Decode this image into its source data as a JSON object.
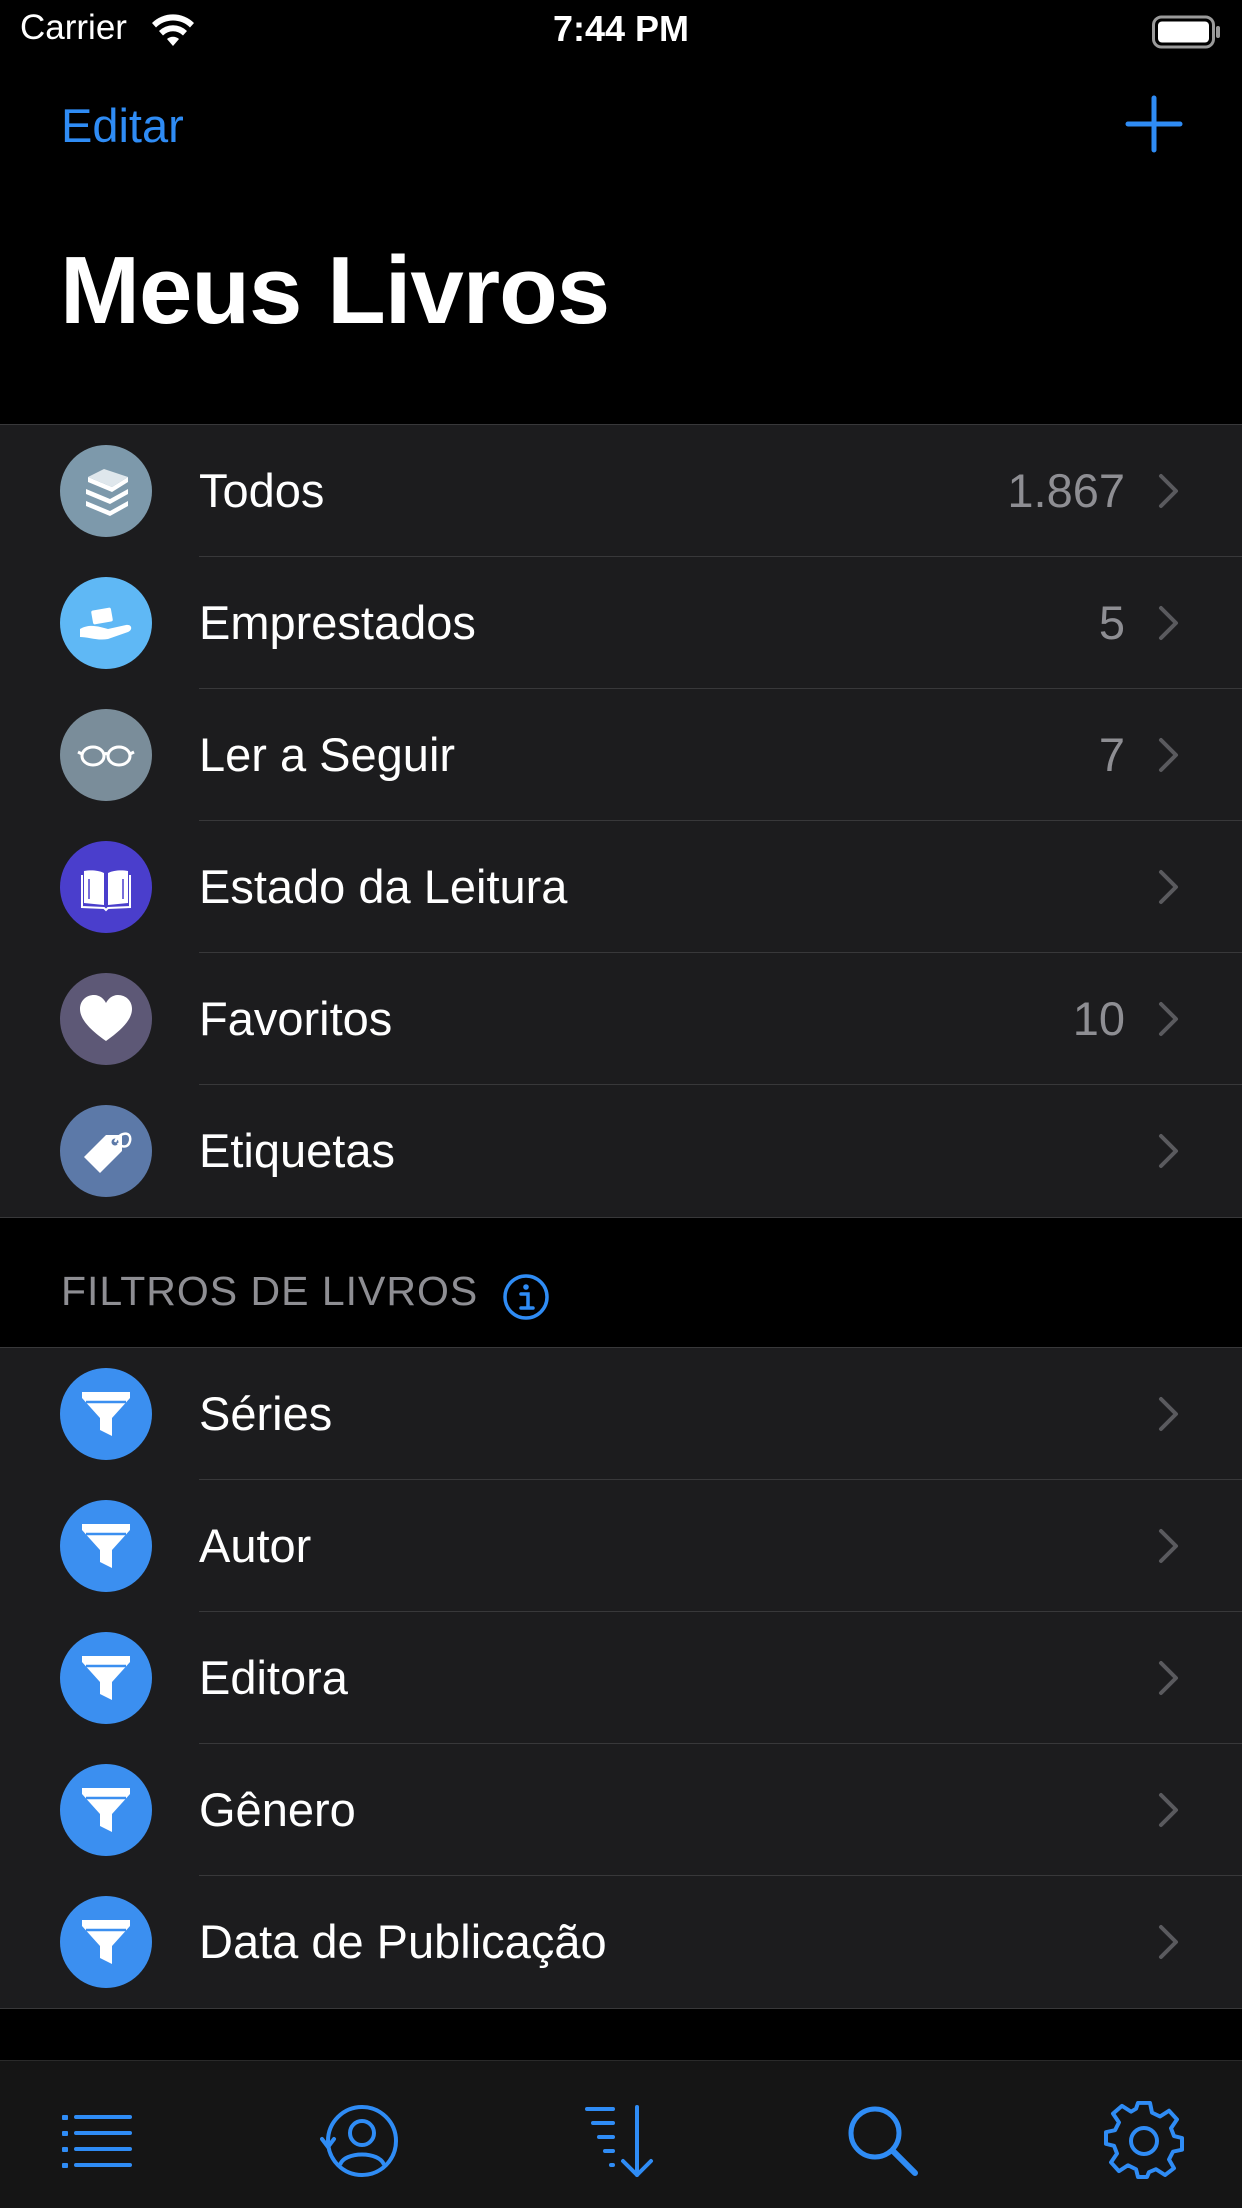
{
  "status": {
    "carrier": "Carrier",
    "time": "7:44 PM"
  },
  "nav": {
    "edit_label": "Editar",
    "add_icon": "plus-icon",
    "title": "Meus Livros"
  },
  "main_list": [
    {
      "label": "Todos",
      "count": "1.867",
      "icon": "books-stack-icon",
      "color": "#7d99ab"
    },
    {
      "label": "Emprestados",
      "count": "5",
      "icon": "hand-giving-icon",
      "color": "#5fb8f5"
    },
    {
      "label": "Ler a Seguir",
      "count": "7",
      "icon": "glasses-icon",
      "color": "#7a8d9a"
    },
    {
      "label": "Estado da Leitura",
      "count": "",
      "icon": "open-book-icon",
      "color": "#4a3ecc"
    },
    {
      "label": "Favoritos",
      "count": "10",
      "icon": "heart-icon",
      "color": "#5d5876"
    },
    {
      "label": "Etiquetas",
      "count": "",
      "icon": "tag-icon",
      "color": "#5c79a8"
    }
  ],
  "filters_section": {
    "header": "FILTROS DE LIVROS",
    "info_icon": "info-icon"
  },
  "filters_list": [
    {
      "label": "Séries",
      "icon": "filter-funnel-icon",
      "color": "#3b8ff0"
    },
    {
      "label": "Autor",
      "icon": "filter-funnel-icon",
      "color": "#3b8ff0"
    },
    {
      "label": "Editora",
      "icon": "filter-funnel-icon",
      "color": "#3b8ff0"
    },
    {
      "label": "Gênero",
      "icon": "filter-funnel-icon",
      "color": "#3b8ff0"
    },
    {
      "label": "Data de Publicação",
      "icon": "filter-funnel-icon",
      "color": "#3b8ff0"
    }
  ],
  "tab_bar": [
    {
      "icon": "list-icon"
    },
    {
      "icon": "contact-icon"
    },
    {
      "icon": "sort-icon"
    },
    {
      "icon": "search-icon"
    },
    {
      "icon": "gear-icon"
    }
  ],
  "colors": {
    "accent": "#2f8cf5",
    "background": "#000000",
    "cell": "#1c1c1e",
    "secondary_text": "#8e8e93"
  }
}
